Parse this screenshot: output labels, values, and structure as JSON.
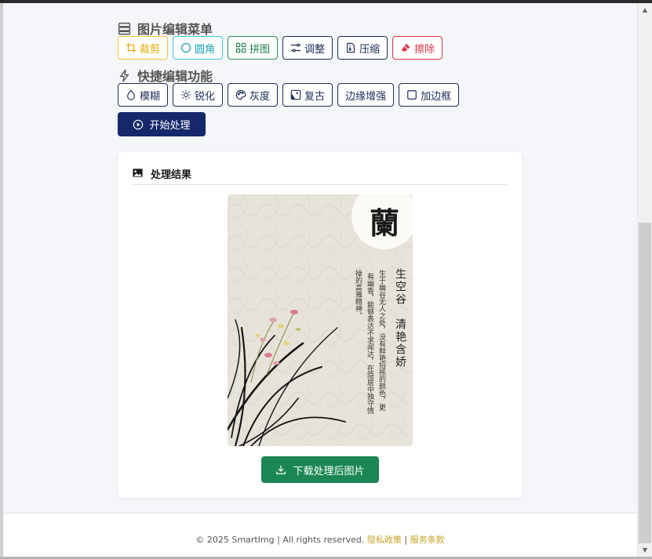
{
  "menu": {
    "title": "图片编辑菜单",
    "buttons": [
      {
        "label": "裁剪",
        "icon": "crop-icon",
        "color": "#e0a800"
      },
      {
        "label": "圆角",
        "icon": "circle-icon",
        "color": "#17a2b8"
      },
      {
        "label": "拼图",
        "icon": "grid-icon",
        "color": "#1e7e4c"
      },
      {
        "label": "调整",
        "icon": "sliders-icon",
        "color": "#1c2b5a"
      },
      {
        "label": "压缩",
        "icon": "file-zip-icon",
        "color": "#1c2b5a"
      },
      {
        "label": "擦除",
        "icon": "eraser-icon",
        "color": "#dc3545"
      }
    ]
  },
  "quick": {
    "title": "快捷编辑功能",
    "buttons": [
      {
        "label": "模糊",
        "icon": "droplet-icon"
      },
      {
        "label": "锐化",
        "icon": "sun-icon"
      },
      {
        "label": "灰度",
        "icon": "palette-icon"
      },
      {
        "label": "复古",
        "icon": "image-vintage-icon"
      },
      {
        "label": "边缘增强",
        "icon": ""
      },
      {
        "label": "加边框",
        "icon": "square-icon"
      }
    ]
  },
  "start_button": "开始处理",
  "result": {
    "title": "处理结果",
    "image": {
      "seal_char": "蘭",
      "heading_lines": [
        "生空谷",
        "清艳含娇"
      ],
      "body_lines": [
        "生于幽谷无人之处，没有鲜艳招摇的颜色，更",
        "有幽香，能够表达不求闻达，在隐居中独守情",
        "操的高雅精神。"
      ]
    },
    "download_button": "下载处理后图片"
  },
  "footer": {
    "text": "© 2025 SmartImg | All rights reserved.",
    "privacy": "隐私政策",
    "separator": "|",
    "terms": "服务条款"
  }
}
